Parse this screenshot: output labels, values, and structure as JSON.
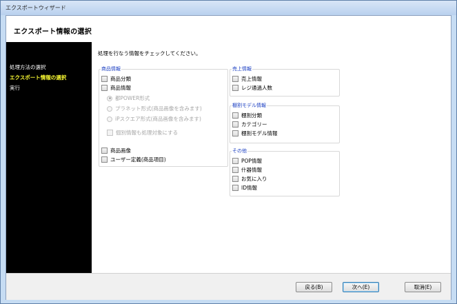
{
  "window": {
    "title": "エクスポートウィザード"
  },
  "header": {
    "title": "エクスポート情報の選択"
  },
  "sidebar": {
    "items": [
      {
        "label": "処理方法の選択",
        "active": false
      },
      {
        "label": "エクスポート情報の選択",
        "active": true
      },
      {
        "label": "実行",
        "active": false
      }
    ]
  },
  "instruction": "処理を行なう情報をチェックしてください。",
  "groups": {
    "product": {
      "label": "商品情報",
      "items": {
        "category": "商品分類",
        "info": "商品情報",
        "radio_1": "都POWER形式",
        "radio_2": "プラネット形式(商品画像を含みます)",
        "radio_3": "iPスクエア形式(商品画像を含みます)",
        "individual": "個別情報も処理対象にする",
        "image": "商品画像",
        "user_defined": "ユーザー定義(商品項目)"
      }
    },
    "sales": {
      "label": "売上情報",
      "items": {
        "sales_info": "売上情報",
        "register_count": "レジ通過人数"
      }
    },
    "shelf": {
      "label": "棚割モデル情報",
      "items": {
        "shelf_category": "棚割分類",
        "category": "カテゴリー",
        "shelf_model": "棚割モデル情報"
      }
    },
    "other": {
      "label": "その他",
      "items": {
        "pop": "POP情報",
        "fixtures": "什器情報",
        "favorites": "お気に入り",
        "id_info": "ID情報"
      }
    }
  },
  "footer": {
    "back": "戻る(B)",
    "next": "次へ(E)",
    "cancel": "取消(E)"
  }
}
